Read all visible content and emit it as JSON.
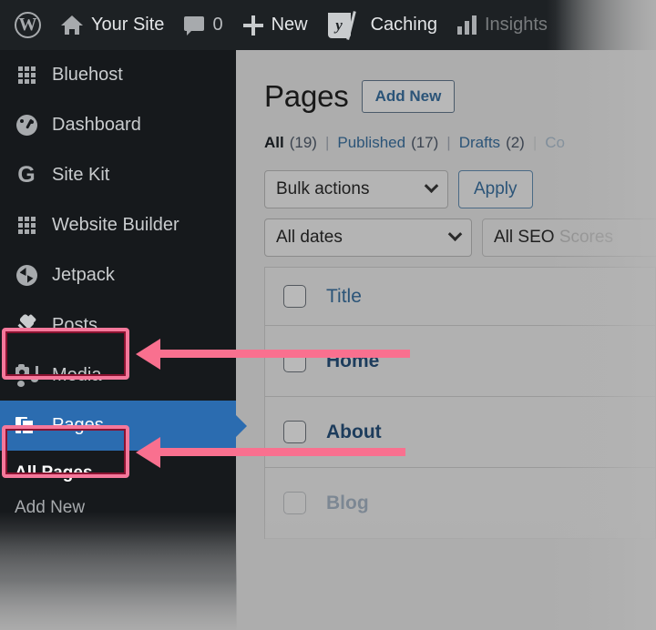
{
  "adminbar": {
    "items": [
      {
        "name": "wordpress-logo",
        "icon": "wordpress-icon",
        "label": ""
      },
      {
        "name": "site-name",
        "icon": "home-icon",
        "label": "Your Site"
      },
      {
        "name": "comments",
        "icon": "comment-bubble-icon",
        "label": "0"
      },
      {
        "name": "new-content",
        "icon": "plus-icon",
        "label": "New"
      },
      {
        "name": "yoast-seo",
        "icon": "yoast-icon",
        "label": ""
      },
      {
        "name": "caching",
        "icon": "none",
        "label": "Caching"
      },
      {
        "name": "insights",
        "icon": "bar-chart-icon",
        "label": "Insights"
      }
    ]
  },
  "sidebar": {
    "items": [
      {
        "label": "Bluehost",
        "icon": "grid-icon",
        "current": false
      },
      {
        "label": "Dashboard",
        "icon": "gauge-icon",
        "current": false
      },
      {
        "label": "Site Kit",
        "icon": "google-g-icon",
        "current": false
      },
      {
        "label": "Website Builder",
        "icon": "grid-icon",
        "current": false
      },
      {
        "label": "Jetpack",
        "icon": "jetpack-icon",
        "current": false
      },
      {
        "label": "Posts",
        "icon": "pushpin-icon",
        "current": false
      },
      {
        "label": "Media",
        "icon": "media-icon",
        "current": false
      },
      {
        "label": "Pages",
        "icon": "pages-icon",
        "current": true
      }
    ],
    "submenu": [
      {
        "label": "All Pages",
        "current": true
      },
      {
        "label": "Add New",
        "current": false
      }
    ]
  },
  "main": {
    "page_title": "Pages",
    "add_new_label": "Add New",
    "status_links": [
      {
        "label": "All",
        "count": "(19)",
        "current": true,
        "faded": false
      },
      {
        "label": "Published",
        "count": "(17)",
        "current": false,
        "faded": false
      },
      {
        "label": "Drafts",
        "count": "(2)",
        "current": false,
        "faded": false
      },
      {
        "label": "Co",
        "count": "",
        "current": false,
        "faded": true
      }
    ],
    "separator": "|",
    "bulk_actions_label": "Bulk actions",
    "apply_label": "Apply",
    "all_dates_label": "All dates",
    "seo_scores_label_visible": "All SEO ",
    "seo_scores_label_faded": "Scores",
    "table": {
      "column_title": "Title",
      "rows": [
        {
          "title": "Home",
          "faded": false
        },
        {
          "title": "About",
          "faded": false
        },
        {
          "title": "Blog",
          "faded": true
        }
      ]
    }
  },
  "annotations": {
    "highlight_color": "#F5789B",
    "arrow_color": "#F9708F",
    "active_menu_color": "#2B6CB0",
    "boxes": [
      {
        "name": "posts-highlight"
      },
      {
        "name": "pages-highlight"
      }
    ],
    "arrows": [
      {
        "name": "arrow-to-posts",
        "direction": "left"
      },
      {
        "name": "arrow-to-pages",
        "direction": "left"
      }
    ]
  }
}
